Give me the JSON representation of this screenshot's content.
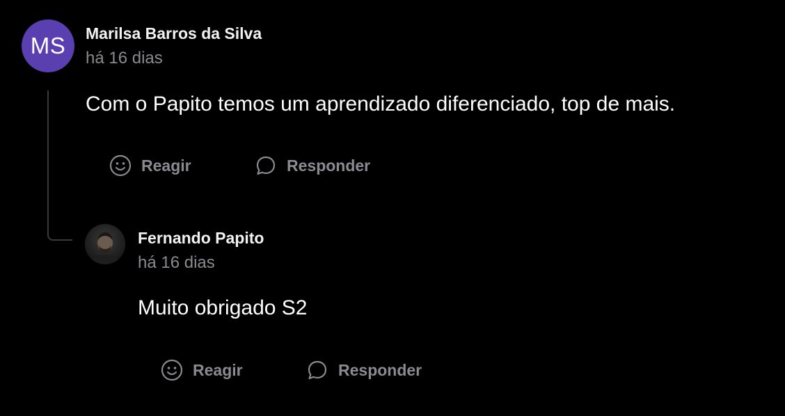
{
  "comment": {
    "avatar_initials": "MS",
    "avatar_color": "#5a3fb0",
    "author": "Marilsa Barros da Silva",
    "time": "há 16 dias",
    "text": "Com o Papito temos um aprendizado diferenciado, top de mais.",
    "actions": {
      "react_label": "Reagir",
      "reply_label": "Responder"
    }
  },
  "reply": {
    "avatar_icon": "profile-photo-icon",
    "author": "Fernando Papito",
    "time": "há 16 dias",
    "text": "Muito obrigado S2",
    "actions": {
      "react_label": "Reagir",
      "reply_label": "Responder"
    }
  },
  "colors": {
    "background": "#000000",
    "text_primary": "#ffffff",
    "text_muted": "#8a8a8f",
    "thread_line": "#3a3a3a"
  },
  "icons": {
    "react": "smile-icon",
    "reply": "chat-bubble-icon"
  }
}
